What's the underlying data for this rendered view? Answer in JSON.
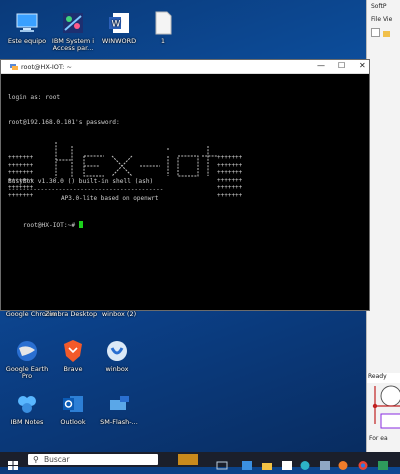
{
  "desktop": {
    "top_icons": [
      {
        "label": "Este equipo",
        "icon": "computer-icon"
      },
      {
        "label": "IBM System i Access par...",
        "icon": "ibm-access-icon"
      },
      {
        "label": "WINWORD",
        "icon": "word-icon"
      },
      {
        "label": "1",
        "icon": "document-icon"
      }
    ],
    "mid_icons": [
      {
        "label": "Google Chrome",
        "icon": "chrome-icon"
      },
      {
        "label": "Zimbra Desktop",
        "icon": "zimbra-icon"
      },
      {
        "label": "winbox (2)",
        "icon": "winbox-icon"
      }
    ],
    "row2_icons": [
      {
        "label": "Google Earth Pro",
        "icon": "google-earth-icon"
      },
      {
        "label": "Brave",
        "icon": "brave-icon"
      },
      {
        "label": "winbox",
        "icon": "winbox-icon"
      }
    ],
    "row3_icons": [
      {
        "label": "IBM Notes",
        "icon": "ibm-notes-icon"
      },
      {
        "label": "Outlook",
        "icon": "outlook-icon"
      },
      {
        "label": "SM-Flash-...",
        "icon": "flash-tool-icon"
      }
    ]
  },
  "terminal": {
    "title": "root@HX-IOT: ~",
    "lines": [
      "login as: root",
      "root@192.168.0.101's password:",
      "",
      "",
      "BusyBox v1.30.0 () built-in shell (ash)",
      ""
    ],
    "banner_hashes": "+++++++",
    "banner_caption": "AP3.0-lite based on openwrt",
    "banner_rule": "-------------------------------------------",
    "prompt": "root@HX-IOT:~# "
  },
  "bg_window": {
    "title": "SoftP",
    "menu": "File  Vie",
    "status": "Ready",
    "footer": "For ea"
  },
  "taskbar": {
    "search_placeholder": "Buscar"
  },
  "colors": {
    "desktop": "#0d4f9e",
    "terminal_bg": "#000000",
    "cursor": "#1bd11b",
    "taskbar": "#1b1f2b"
  }
}
